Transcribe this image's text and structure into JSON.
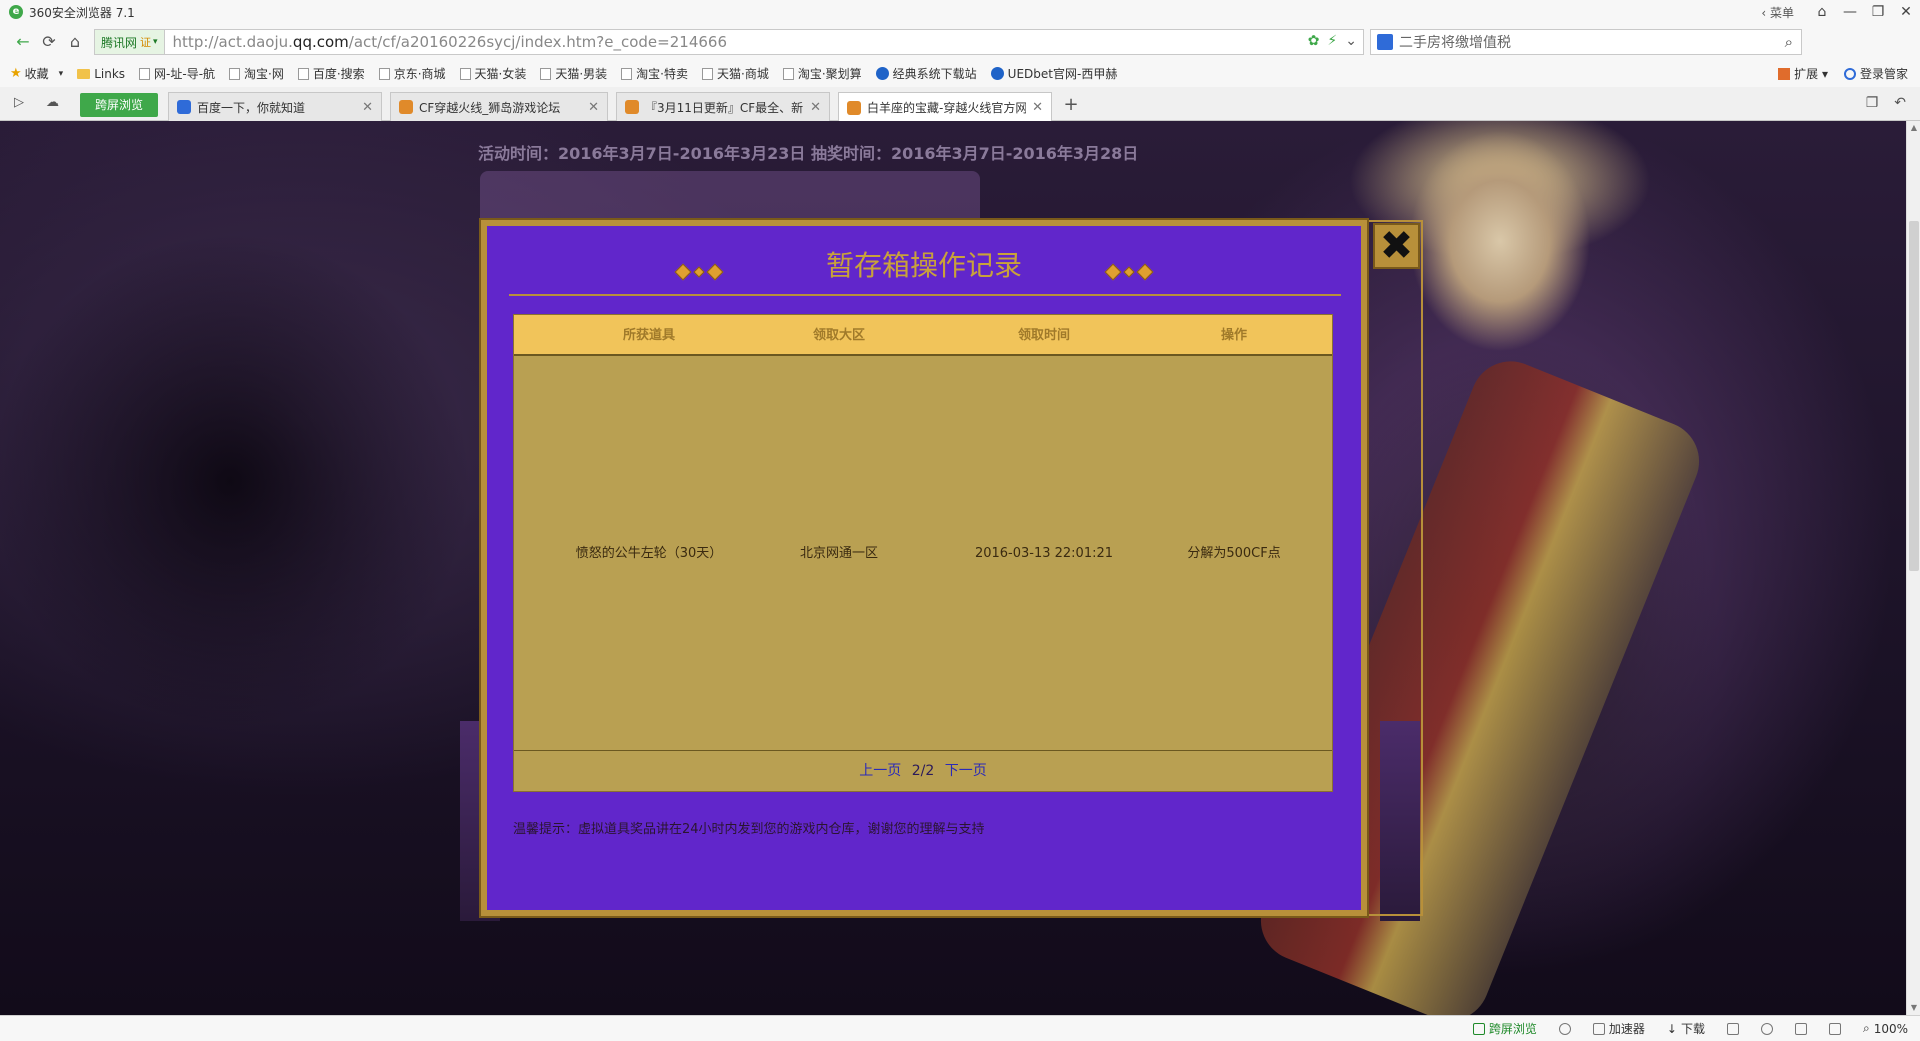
{
  "window": {
    "title": "360安全浏览器 7.1",
    "menu_label": "菜单",
    "controls": [
      "⌂",
      "—",
      "❐",
      "✕"
    ]
  },
  "address": {
    "cert_label": "腾讯网",
    "cert_badge": "证",
    "url_prefix": "http://act.daoju.",
    "url_domain": "qq.com",
    "url_suffix": "/act/cf/a20160226sycj/index.htm?e_code=214666",
    "search_text": "二手房将缴增值税"
  },
  "bookmarks": {
    "favorites": "收藏",
    "items": [
      "Links",
      "网-址-导-航",
      "淘宝·网",
      "百度·搜索",
      "京东·商城",
      "天猫·女装",
      "天猫·男装",
      "淘宝·特卖",
      "天猫·商城",
      "淘宝·聚划算",
      "经典系统下载站",
      "UEDbet官网-西甲赫"
    ],
    "extensions": "扩展",
    "login": "登录管家"
  },
  "tabs": {
    "split_label": "跨屏浏览",
    "items": [
      {
        "label": "百度一下，你就知道",
        "active": false,
        "color": "#2f6bd8"
      },
      {
        "label": "CF穿越火线_狮岛游戏论坛",
        "active": false,
        "color": "#e08a2a"
      },
      {
        "label": "『3月11日更新』CF最全、新.",
        "active": false,
        "color": "#e08a2a"
      },
      {
        "label": "白羊座的宝藏-穿越火线官方网:",
        "active": true,
        "color": "#e08a2a"
      }
    ]
  },
  "page": {
    "activity_time": "活动时间：2016年3月7日-2016年3月23日 抽奖时间：2016年3月7日-2016年3月28日"
  },
  "modal": {
    "title": "暂存箱操作记录",
    "close_glyph": "✖",
    "columns": [
      "所获道具",
      "领取大区",
      "领取时间",
      "操作"
    ],
    "rows": [
      [
        "愤怒的公牛左轮（30天）",
        "北京网通一区",
        "2016-03-13 22:01:21",
        "分解为500CF点"
      ]
    ],
    "pager": {
      "prev": "上一页",
      "page": "2/2",
      "next": "下一页"
    },
    "tip": "温馨提示：虚拟道具奖品讲在24小时内发到您的游戏内仓库，谢谢您的理解与支持"
  },
  "statusbar": {
    "split": "跨屏浏览",
    "accelerator": "加速器",
    "download": "下载",
    "zoom": "100%"
  },
  "colors": {
    "modal_bg": "#6126cb",
    "modal_border": "#b8903a",
    "table_header": "#f1c45a",
    "table_body": "#b9a052",
    "title_gold": "#c9a23a"
  }
}
